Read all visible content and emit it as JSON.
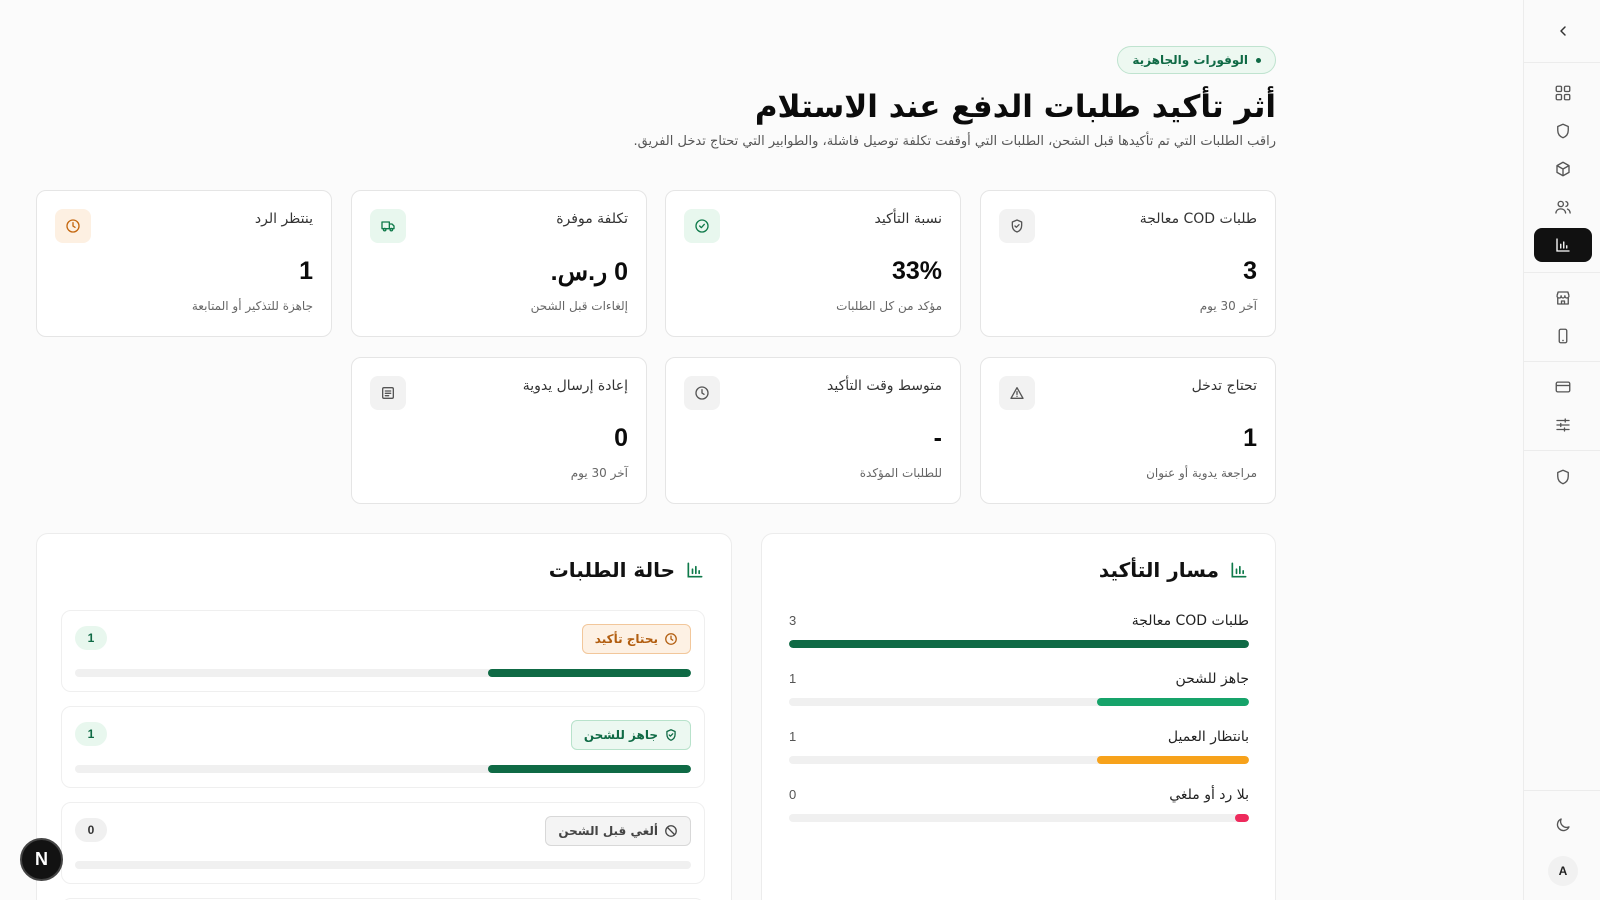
{
  "header": {
    "pill": "الوفورات والجاهزية",
    "title": "أثر تأكيد طلبات الدفع عند الاستلام",
    "subtitle": "راقب الطلبات التي تم تأكيدها قبل الشحن، الطلبات التي أوقفت تكلفة توصيل فاشلة، والطوابير التي تحتاج تدخل الفريق."
  },
  "stats": [
    {
      "label": "طلبات COD معالجة",
      "value": "3",
      "note": "آخر 30 يوم",
      "icon": "shield-check-icon",
      "tone": "gray"
    },
    {
      "label": "نسبة التأكيد",
      "value": "33%",
      "note": "مؤكد من كل الطلبات",
      "icon": "check-circle-icon",
      "tone": "green"
    },
    {
      "label": "تكلفة موفرة",
      "value": "0 ر.س.",
      "note": "إلغاءات قبل الشحن",
      "icon": "truck-icon",
      "tone": "green"
    },
    {
      "label": "ينتظر الرد",
      "value": "1",
      "note": "جاهزة للتذكير أو المتابعة",
      "icon": "clock-icon",
      "tone": "orange"
    },
    {
      "label": "تحتاج تدخل",
      "value": "1",
      "note": "مراجعة يدوية أو عنوان",
      "icon": "warning-icon",
      "tone": "gray"
    },
    {
      "label": "متوسط وقت التأكيد",
      "value": "-",
      "note": "للطلبات المؤكدة",
      "icon": "clock-icon",
      "tone": "gray"
    },
    {
      "label": "إعادة إرسال يدوية",
      "value": "0",
      "note": "آخر 30 يوم",
      "icon": "message-icon",
      "tone": "gray"
    }
  ],
  "pipeline": {
    "title": "مسار التأكيد",
    "rows": [
      {
        "label": "طلبات COD معالجة",
        "count": "3",
        "fraction": 1.0,
        "color": "#0f6a45"
      },
      {
        "label": "جاهز للشحن",
        "count": "1",
        "fraction": 0.33,
        "color": "#16a36a"
      },
      {
        "label": "بانتظار العميل",
        "count": "1",
        "fraction": 0.33,
        "color": "#f7a21b"
      },
      {
        "label": "بلا رد أو ملغي",
        "count": "0",
        "fraction": 0.03,
        "color": "#ee2a5c"
      }
    ]
  },
  "status": {
    "title": "حالة الطلبات",
    "rows": [
      {
        "label": "يحتاج تأكيد",
        "count": "1",
        "fraction": 0.33,
        "tone": "orange",
        "icon": "clock-icon"
      },
      {
        "label": "جاهز للشحن",
        "count": "1",
        "fraction": 0.33,
        "tone": "green",
        "icon": "shield-check-icon"
      },
      {
        "label": "ألغي قبل الشحن",
        "count": "0",
        "fraction": 0,
        "tone": "gray",
        "icon": "ban-icon"
      }
    ]
  },
  "user": {
    "avatar": "A"
  },
  "fab": {
    "label": "N"
  }
}
